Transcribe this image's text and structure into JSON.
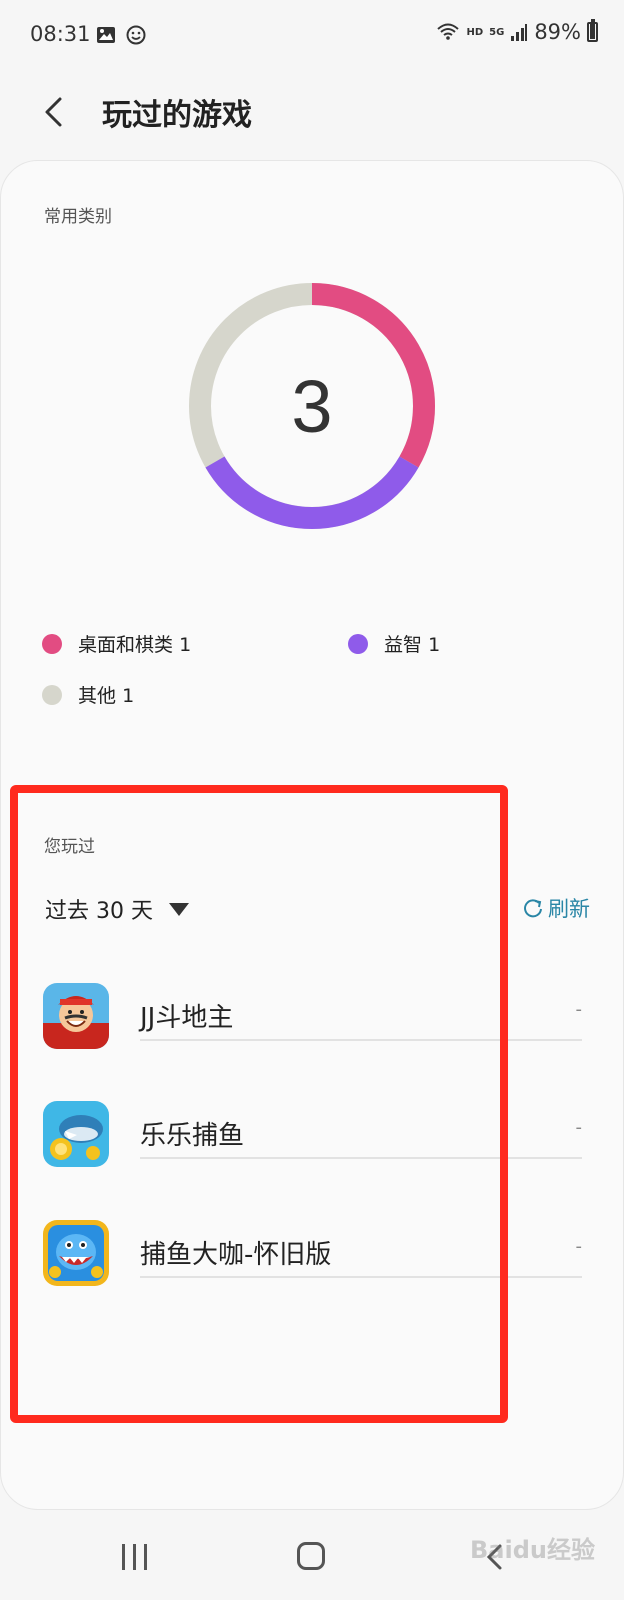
{
  "status_bar": {
    "time": "08:31",
    "battery": "89%",
    "network_hd": "HD",
    "network_5g": "5G"
  },
  "header": {
    "title": "玩过的游戏"
  },
  "categories": {
    "label": "常用类别",
    "total": "3",
    "items": [
      {
        "name": "桌面和棋类",
        "count": "1",
        "color": "#e24c82"
      },
      {
        "name": "益智",
        "count": "1",
        "color": "#8f5bea"
      },
      {
        "name": "其他",
        "count": "1",
        "color": "#d6d6cc"
      }
    ]
  },
  "played": {
    "label": "您玩过",
    "filter": "过去 30 天",
    "refresh": "刷新",
    "games": [
      {
        "name": "JJ斗地主",
        "value": "-"
      },
      {
        "name": "乐乐捕鱼",
        "value": "-"
      },
      {
        "name": "捕鱼大咖-怀旧版",
        "value": "-"
      }
    ]
  },
  "watermark": "Baidu经验"
}
